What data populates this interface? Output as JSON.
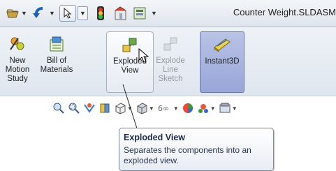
{
  "window": {
    "title": "Counter Weight.SLDASM"
  },
  "ribbon": {
    "new_motion_study": "New\nMotion\nStudy",
    "bill_of_materials": "Bill of\nMaterials",
    "exploded_view": "Exploded\nView",
    "explode_line_sketch": "Explode\nLine\nSketch",
    "instant3d": "Instant3D"
  },
  "tooltip": {
    "title": "Exploded View",
    "description": "Separates the components into an exploded view."
  },
  "icons": {
    "quick_access": [
      "open-icon",
      "undo-icon",
      "select-arrow-icon",
      "traffic-light-icon",
      "options-icon",
      "customize-icon"
    ],
    "view_tools": [
      "zoom-to-fit-icon",
      "zoom-to-area-icon",
      "previous-view-icon",
      "section-view-icon",
      "view-orientation-icon",
      "display-style-icon",
      "hide-show-items-icon",
      "edit-appearance-icon",
      "apply-scene-icon",
      "view-settings-icon"
    ]
  }
}
